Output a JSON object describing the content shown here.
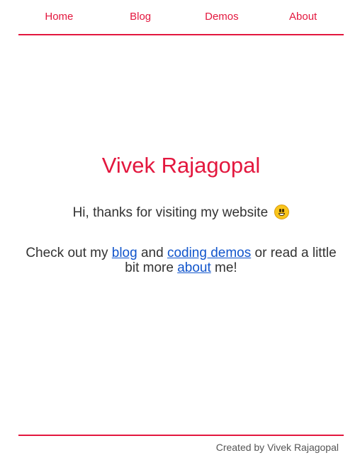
{
  "nav": {
    "items": [
      {
        "label": "Home"
      },
      {
        "label": "Blog"
      },
      {
        "label": "Demos"
      },
      {
        "label": "About"
      }
    ]
  },
  "hero": {
    "title": "Vivek Rajagopal",
    "greeting": "Hi, thanks for visiting my website",
    "emoji": "grinning-face-icon"
  },
  "intro": {
    "part1": "Check out my ",
    "blog_link": "blog",
    "part2": " and ",
    "demos_link": "coding demos",
    "part3": " or read a little bit more ",
    "about_link": "about",
    "part4": " me!"
  },
  "footer": {
    "text": "Created by Vivek Rajagopal"
  },
  "colors": {
    "accent": "#e3173e",
    "link": "#1155cc",
    "text": "#333333"
  }
}
